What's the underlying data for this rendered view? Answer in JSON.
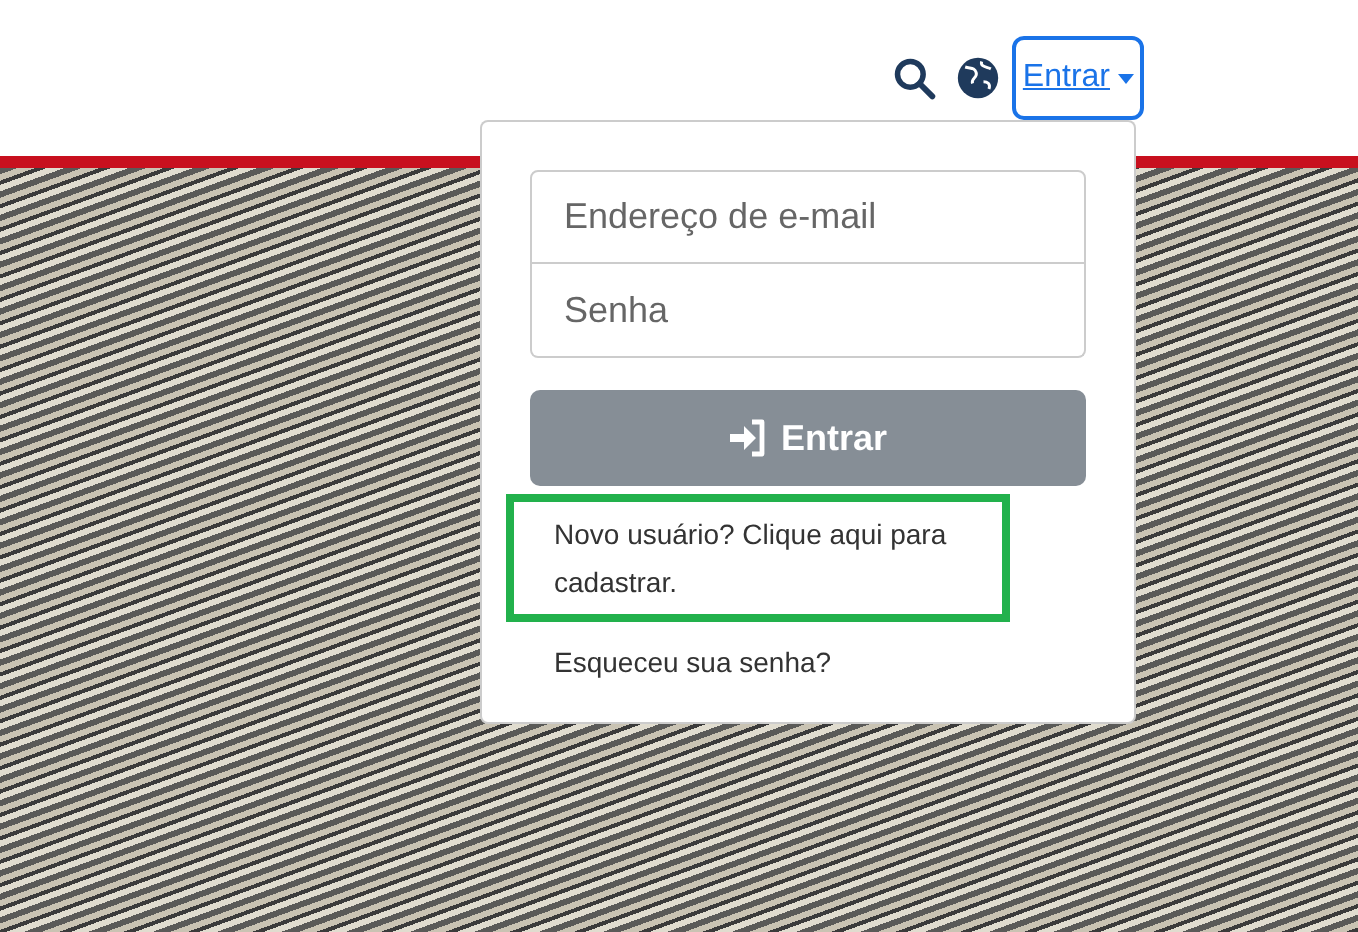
{
  "header": {
    "login_toggle": {
      "label": "Entrar",
      "expanded": true
    }
  },
  "login_menu": {
    "email": {
      "placeholder": "Endereço de e-mail"
    },
    "password": {
      "placeholder": "Senha"
    },
    "submit": {
      "label": "Entrar"
    },
    "links": [
      {
        "text": "Novo usuário? Clique aqui para cadastrar.",
        "highlighted": true
      },
      {
        "text": "Esqueceu sua senha?",
        "highlighted": false
      }
    ]
  }
}
